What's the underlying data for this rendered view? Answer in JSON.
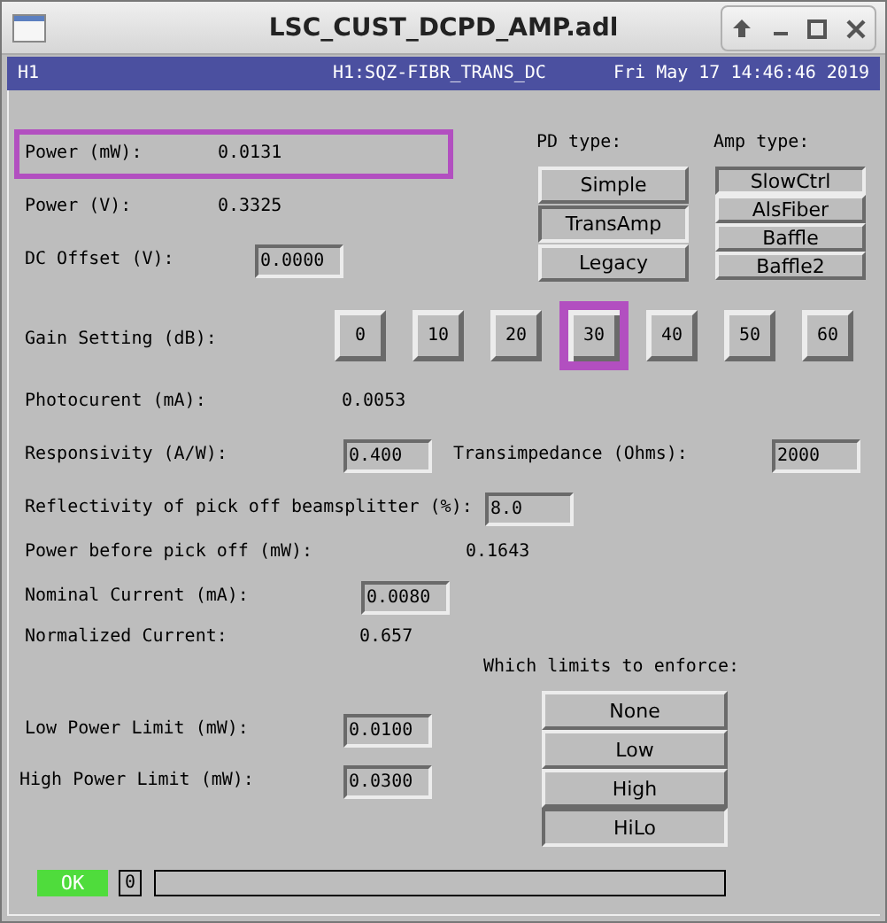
{
  "window": {
    "title": "LSC_CUST_DCPD_AMP.adl"
  },
  "header": {
    "site": "H1",
    "channel": "H1:SQZ-FIBR_TRANS_DC",
    "timestamp": "Fri May 17 14:46:46 2019"
  },
  "fields": [
    {
      "kind": "readout",
      "label": "Power (mW):",
      "value": "0.0131",
      "highlighted": true
    },
    {
      "kind": "readout",
      "label": "Power (V):",
      "value": "0.3325",
      "highlighted": false
    },
    {
      "kind": "input",
      "label": "DC Offset (V):",
      "value": "0.0000",
      "highlighted": false
    },
    {
      "kind": "readout",
      "label": "Photocurent (mA):",
      "value": "0.0053",
      "highlighted": false
    },
    {
      "kind": "input",
      "label": "Responsivity (A/W):",
      "value": "0.400",
      "highlighted": false
    },
    {
      "kind": "input",
      "label": "Transimpedance (Ohms):",
      "value": "2000",
      "highlighted": false
    },
    {
      "kind": "input",
      "label": "Reflectivity of pick off beamsplitter (%):",
      "value": "8.0",
      "highlighted": false
    },
    {
      "kind": "readout",
      "label": "Power before pick off (mW):",
      "value": "0.1643",
      "highlighted": false
    },
    {
      "kind": "input",
      "label": "Nominal Current (mA):",
      "value": "0.0080",
      "highlighted": false
    },
    {
      "kind": "readout",
      "label": "Normalized Current:",
      "value": "0.657",
      "highlighted": false
    },
    {
      "kind": "input",
      "label": "Low Power Limit (mW):",
      "value": "0.0100",
      "highlighted": false
    },
    {
      "kind": "input",
      "label": "High Power Limit (mW):",
      "value": "0.0300",
      "highlighted": false
    }
  ],
  "gain": {
    "label": "Gain Setting (dB):",
    "options": [
      {
        "label": "0",
        "highlighted": false
      },
      {
        "label": "10",
        "highlighted": false
      },
      {
        "label": "20",
        "highlighted": false
      },
      {
        "label": "30",
        "highlighted": true
      },
      {
        "label": "40",
        "highlighted": false
      },
      {
        "label": "50",
        "highlighted": false
      },
      {
        "label": "60",
        "highlighted": false
      }
    ]
  },
  "pd_type": {
    "label": "PD type:",
    "options": [
      {
        "label": "Simple",
        "selected": false
      },
      {
        "label": "TransAmp",
        "selected": true
      },
      {
        "label": "Legacy",
        "selected": false
      }
    ]
  },
  "amp_type": {
    "label": "Amp type:",
    "options": [
      {
        "label": "SlowCtrl",
        "selected": true
      },
      {
        "label": "AlsFiber",
        "selected": false
      },
      {
        "label": "Baffle",
        "selected": false
      },
      {
        "label": "Baffle2",
        "selected": false
      }
    ]
  },
  "limits": {
    "label": "Which limits to enforce:",
    "options": [
      {
        "label": "None",
        "selected": false
      },
      {
        "label": "Low",
        "selected": false
      },
      {
        "label": "High",
        "selected": false
      },
      {
        "label": "HiLo",
        "selected": true
      }
    ]
  },
  "status": {
    "state": "OK",
    "count": "0"
  }
}
